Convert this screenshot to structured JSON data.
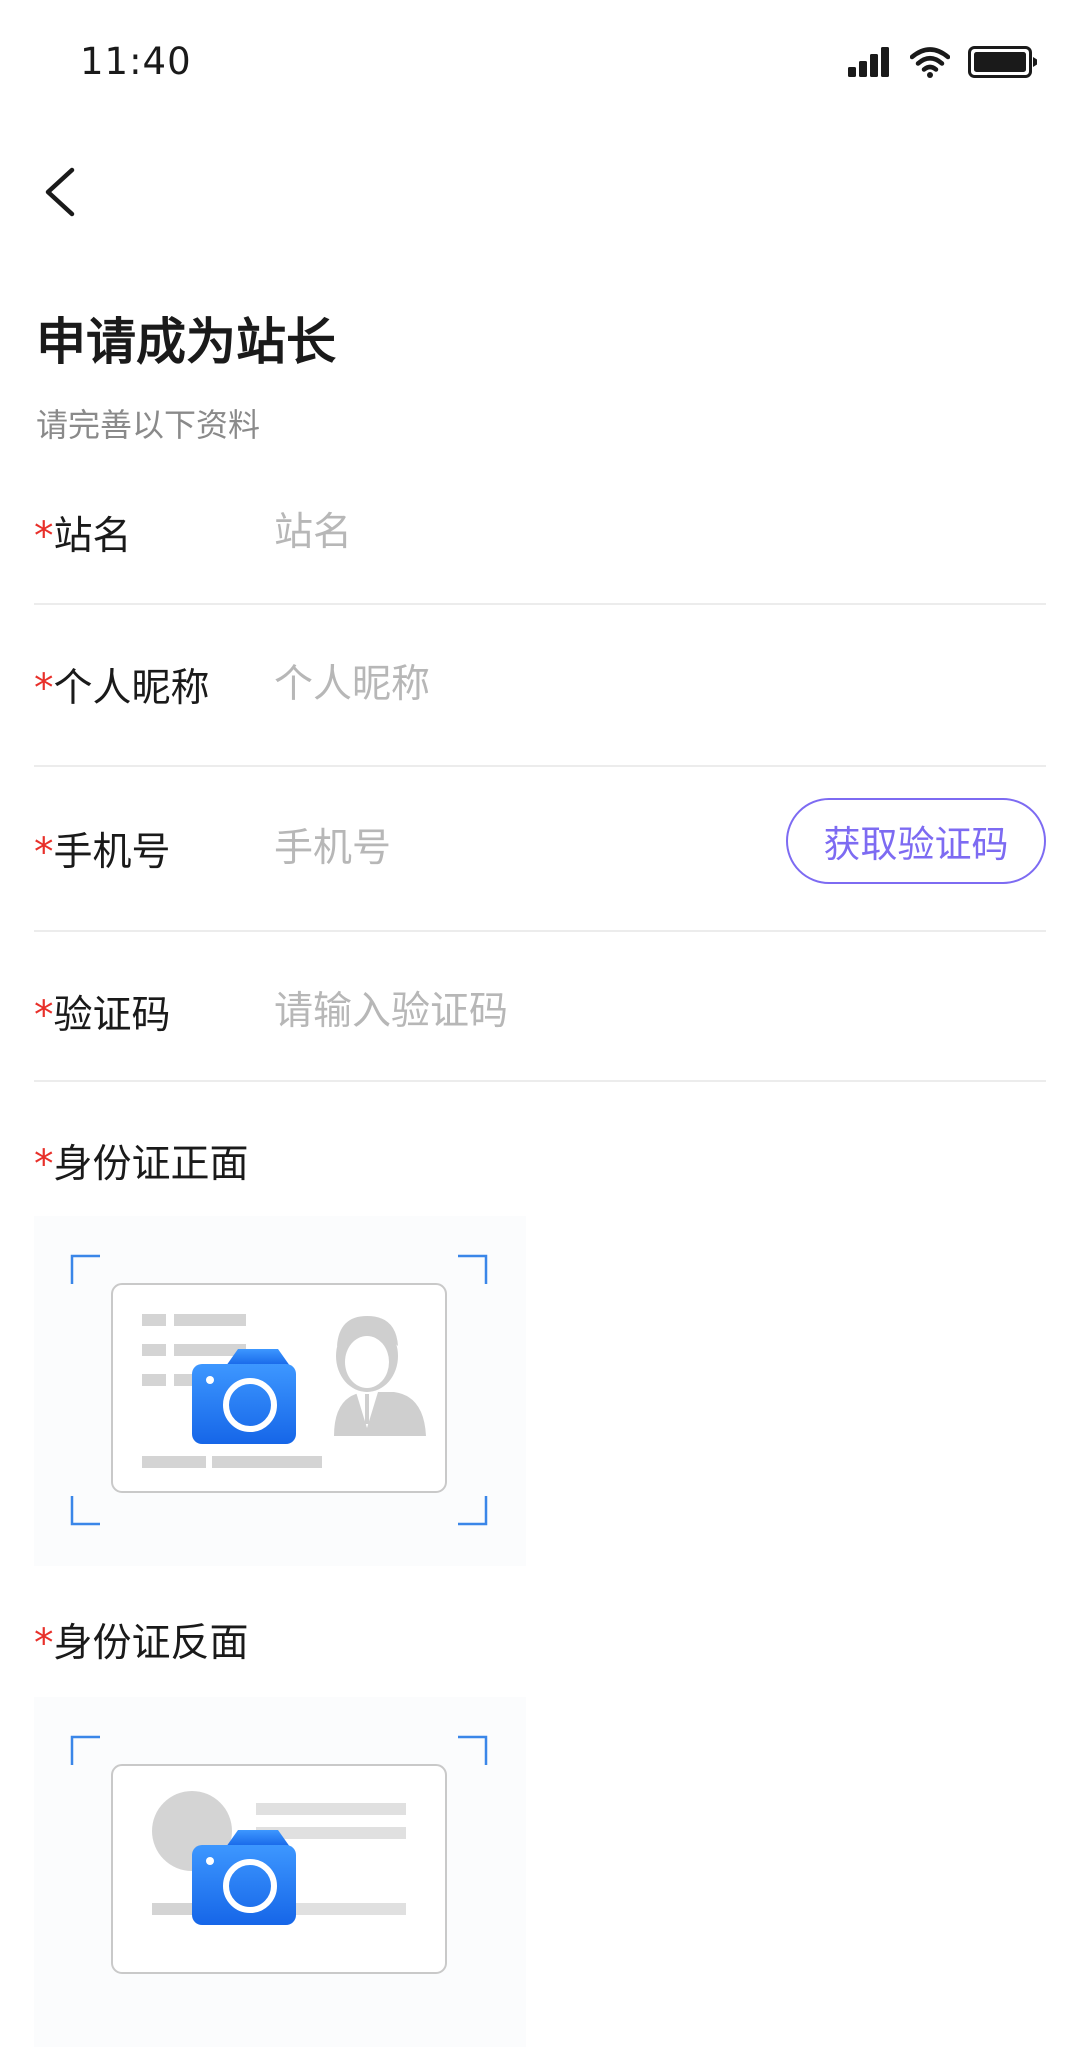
{
  "status_bar": {
    "time": "11:40"
  },
  "header": {
    "back_icon": "chevron-left-icon"
  },
  "page": {
    "title": "申请成为站长",
    "subtitle": "请完善以下资料"
  },
  "form": {
    "required_mark": "*",
    "station_name": {
      "label": "站名",
      "placeholder": "站名",
      "value": ""
    },
    "nickname": {
      "label": "个人昵称",
      "placeholder": "个人昵称",
      "value": ""
    },
    "phone": {
      "label": "手机号",
      "placeholder": "手机号",
      "value": "",
      "code_button_label": "获取验证码"
    },
    "verify_code": {
      "label": "验证码",
      "placeholder": "请输入验证码",
      "value": ""
    },
    "id_front": {
      "label": "身份证正面"
    },
    "id_back": {
      "label": "身份证反面"
    }
  },
  "colors": {
    "accent": "#7d6bf2",
    "required": "#e8302a",
    "camera_blue": "#1f7cf2",
    "corner_blue": "#3a86e8",
    "placeholder": "#b7b7b7",
    "divider": "#ececec"
  }
}
